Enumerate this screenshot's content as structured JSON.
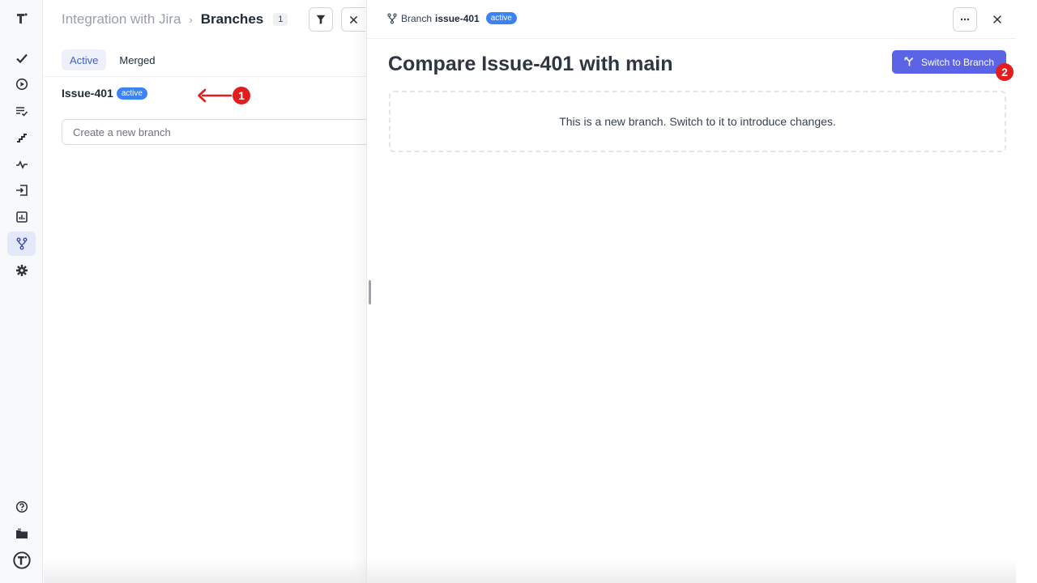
{
  "rail": {
    "items": [
      {
        "name": "logo-icon"
      },
      {
        "name": "tests-check-icon"
      },
      {
        "name": "runs-play-icon"
      },
      {
        "name": "checklist-icon"
      },
      {
        "name": "steps-icon"
      },
      {
        "name": "pulse-icon"
      },
      {
        "name": "import-icon"
      },
      {
        "name": "analytics-icon"
      },
      {
        "name": "branches-icon",
        "active": true
      },
      {
        "name": "settings-gear-icon"
      },
      {
        "name": "help-icon"
      },
      {
        "name": "folder-icon"
      },
      {
        "name": "profile-logo-icon"
      }
    ]
  },
  "header": {
    "project": "Integration with Jira",
    "separator": "›",
    "title": "Branches",
    "count": "1"
  },
  "tabs": [
    {
      "label": "Active",
      "active": true
    },
    {
      "label": "Merged",
      "active": false
    }
  ],
  "branches": [
    {
      "name": "Issue-401",
      "status": "active"
    }
  ],
  "new_branch": {
    "placeholder": "Create a new branch"
  },
  "drawer": {
    "branch_prefix": "Branch",
    "branch_name": "issue-401",
    "status": "active",
    "title": "Compare Issue-401 with main",
    "switch_button": "Switch to Branch",
    "empty_message": "This is a new branch. Switch to it to introduce changes."
  },
  "annotations": [
    {
      "number": "1"
    },
    {
      "number": "2"
    }
  ],
  "colors": {
    "accent": "#5b63e6",
    "active_pill": "#3b82f6",
    "annotation": "#e11d1d",
    "active_tab_text": "#4361c9"
  }
}
